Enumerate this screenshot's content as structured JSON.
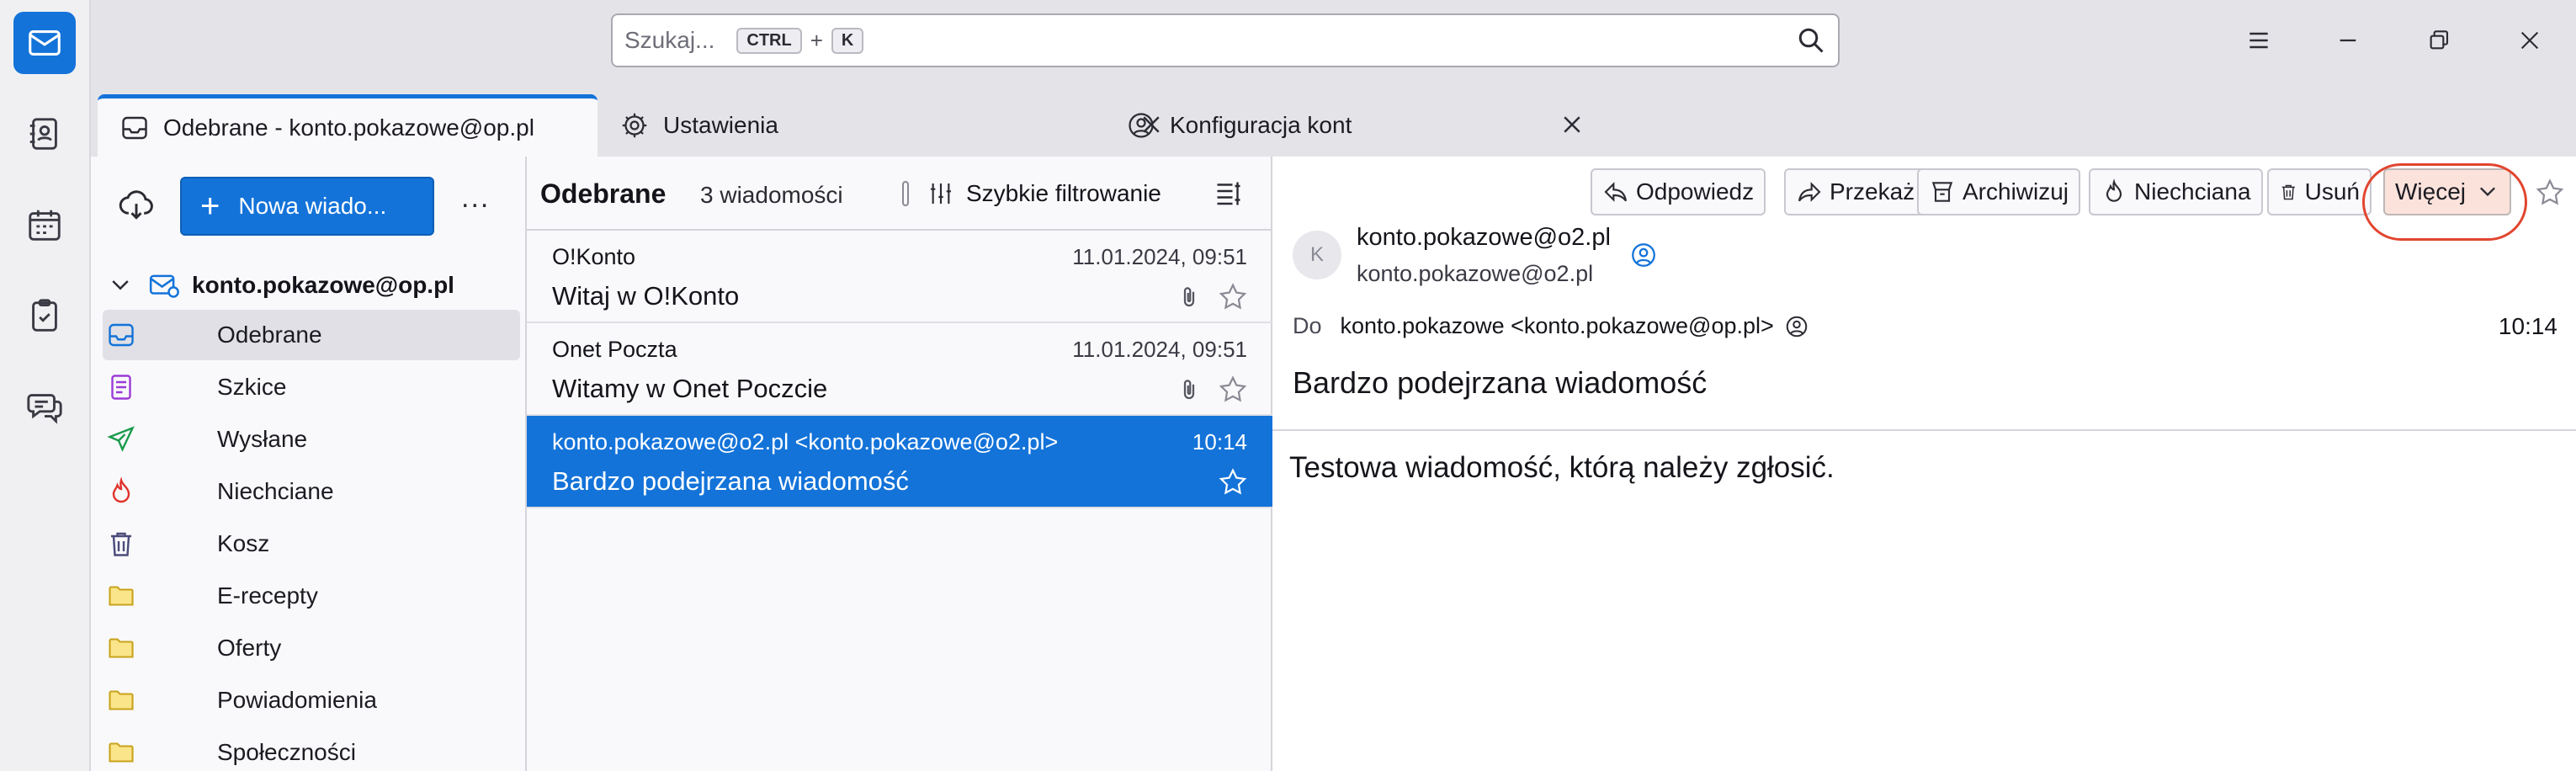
{
  "titlebar": {
    "search_placeholder": "Szukaj...",
    "search_kbd1": "CTRL",
    "search_plus": "+",
    "search_kbd2": "K"
  },
  "tabs": [
    {
      "label": "Odebrane - konto.pokazowe@op.pl",
      "icon": "inbox-icon"
    },
    {
      "label": "Ustawienia",
      "icon": "gear-icon"
    },
    {
      "label": "Konfiguracja kont",
      "icon": "account-settings-icon"
    }
  ],
  "folder_pane": {
    "new_message_label": "Nowa wiado...",
    "more_label": "...",
    "account": "konto.pokazowe@op.pl",
    "folders": [
      {
        "label": "Odebrane",
        "icon": "inbox-icon"
      },
      {
        "label": "Szkice",
        "icon": "drafts-icon"
      },
      {
        "label": "Wysłane",
        "icon": "sent-icon"
      },
      {
        "label": "Niechciane",
        "icon": "junk-icon"
      },
      {
        "label": "Kosz",
        "icon": "trash-icon"
      },
      {
        "label": "E-recepty",
        "icon": "folder-icon"
      },
      {
        "label": "Oferty",
        "icon": "folder-icon"
      },
      {
        "label": "Powiadomienia",
        "icon": "folder-icon"
      },
      {
        "label": "Społeczności",
        "icon": "folder-icon"
      }
    ]
  },
  "message_list": {
    "title": "Odebrane",
    "count": "3 wiadomości",
    "quick_filter_label": "Szybkie filtrowanie",
    "messages": [
      {
        "sender": "O!Konto",
        "date": "11.01.2024, 09:51",
        "subject": "Witaj w O!Konto"
      },
      {
        "sender": "Onet Poczta",
        "date": "11.01.2024, 09:51",
        "subject": "Witamy w Onet Poczcie"
      },
      {
        "sender": "konto.pokazowe@o2.pl <konto.pokazowe@o2.pl>",
        "date": "10:14",
        "subject": "Bardzo podejrzana wiadomość"
      }
    ]
  },
  "reader": {
    "toolbar": {
      "reply": "Odpowiedz",
      "forward": "Przekaż",
      "archive": "Archiwizuj",
      "junk": "Niechciana",
      "delete": "Usuń",
      "more": "Więcej"
    },
    "avatar_letter": "K",
    "from_name": "konto.pokazowe@o2.pl",
    "from_address": "konto.pokazowe@o2.pl",
    "to_label": "Do",
    "to_value": "konto.pokazowe <konto.pokazowe@op.pl>",
    "time": "10:14",
    "subject": "Bardzo podejrzana wiadomość",
    "body": "Testowa wiadomość, którą należy zgłosić."
  },
  "colors": {
    "accent": "#1373d9",
    "highlight_ring": "#e2452e"
  }
}
